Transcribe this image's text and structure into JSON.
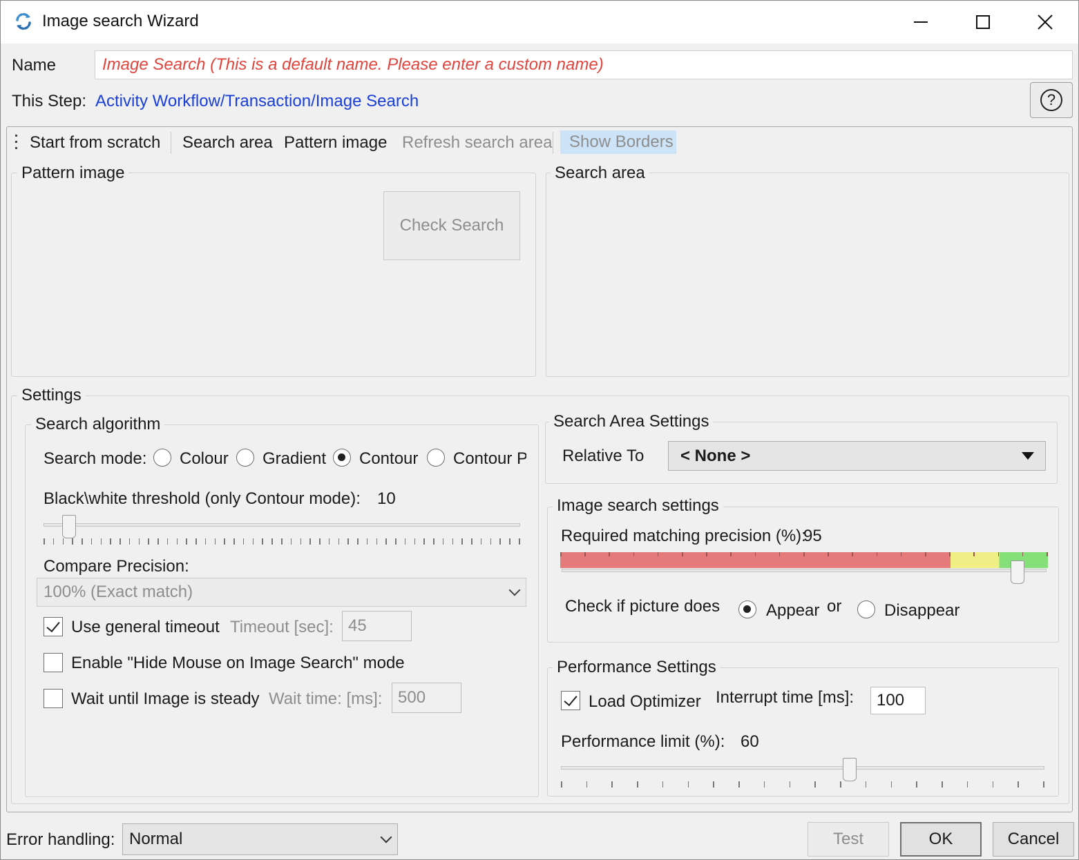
{
  "window": {
    "title": "Image search Wizard",
    "minimize_glyph": "—",
    "maximize_glyph": "☐",
    "close_glyph": "✕",
    "app_icon": "refresh-arrows-icon"
  },
  "header": {
    "name_label": "Name",
    "name_placeholder": "Image Search  (This is a default name. Please enter a custom name)",
    "step_label": "This Step:",
    "step_path": "Activity Workflow/Transaction/Image Search",
    "help_glyph": "?"
  },
  "toolbar": {
    "start_from_scratch": "Start from scratch",
    "search_area": "Search area",
    "pattern_image": "Pattern image",
    "refresh_search_area": "Refresh search area",
    "show_borders": "Show Borders"
  },
  "pattern_panel": {
    "legend": "Pattern image",
    "check_search_label": "Check Search"
  },
  "search_area_panel": {
    "legend": "Search area"
  },
  "settings": {
    "legend": "Settings",
    "algorithm": {
      "legend": "Search algorithm",
      "mode_label": "Search mode:",
      "modes": [
        "Colour",
        "Gradient",
        "Contour",
        "Contour P"
      ],
      "selected_mode": "Contour",
      "threshold_label": "Black\\white threshold (only Contour mode):",
      "threshold_value": "10",
      "threshold_slider_fraction": 0.04,
      "compare_label": "Compare Precision:",
      "compare_value": "100% (Exact match)",
      "general_timeout_label": "Use general timeout",
      "general_timeout_checked": true,
      "timeout_label": "Timeout [sec]:",
      "timeout_value": "45",
      "hide_mouse_label": "Enable \"Hide Mouse on Image Search\" mode",
      "hide_mouse_checked": false,
      "wait_steady_label": "Wait until Image is steady",
      "wait_steady_checked": false,
      "wait_time_label": "Wait time: [ms]:",
      "wait_time_value": "500"
    },
    "search_area_settings": {
      "legend": "Search Area Settings",
      "relative_to_label": "Relative To",
      "relative_to_value": "< None >"
    },
    "image_search_settings": {
      "legend": "Image search settings",
      "precision_label": "Required matching precision (%):",
      "precision_value": "95",
      "precision_fraction": 0.95,
      "colors": {
        "red": "#e57a7a",
        "yellow": "#f0ef86",
        "green": "#86e07a"
      },
      "check_picture_label": "Check if picture does",
      "appear_label": "Appear",
      "or_label": "or",
      "disappear_label": "Disappear",
      "selected": "Appear"
    },
    "performance": {
      "legend": "Performance Settings",
      "load_optimizer_label": "Load Optimizer",
      "load_optimizer_checked": true,
      "interrupt_label": "Interrupt time [ms]:",
      "interrupt_value": "100",
      "limit_label": "Performance limit (%):",
      "limit_value": "60",
      "limit_fraction": 0.6
    }
  },
  "footer": {
    "error_handling_label": "Error handling:",
    "error_handling_value": "Normal",
    "test_label": "Test",
    "ok_label": "OK",
    "cancel_label": "Cancel"
  },
  "colors": {
    "accent_link": "#1a3fd8",
    "placeholder_red": "#e0443c",
    "show_borders_bg": "#cde3f7",
    "disabled_text": "#8d8d8d"
  }
}
